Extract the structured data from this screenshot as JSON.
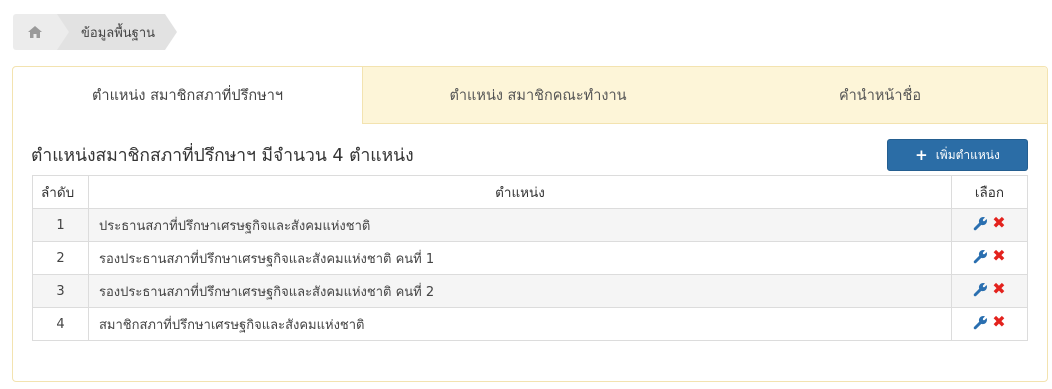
{
  "breadcrumb": {
    "home_icon": "home-icon",
    "current": "ข้อมูลพื้นฐาน"
  },
  "tabs": [
    {
      "label": "ตำแหน่ง สมาชิกสภาที่ปรึกษาฯ",
      "active": true
    },
    {
      "label": "ตำแหน่ง สมาชิกคณะทำงาน",
      "active": false
    },
    {
      "label": "คำนำหน้าชื่อ",
      "active": false
    }
  ],
  "section": {
    "heading": "ตำแหน่งสมาชิกสภาที่ปรึกษาฯ มีจำนวน 4 ตำแหน่ง",
    "add_button": "เพิ่มตำแหน่ง",
    "add_icon": "plus-icon"
  },
  "table": {
    "headers": {
      "no": "ลำดับ",
      "position": "ตำแหน่ง",
      "select": "เลือก"
    },
    "rows": [
      {
        "no": "1",
        "position": "ประธานสภาที่ปรึกษาเศรษฐกิจและสังคมแห่งชาติ"
      },
      {
        "no": "2",
        "position": "รองประธานสภาที่ปรึกษาเศรษฐกิจและสังคมแห่งชาติ คนที่ 1"
      },
      {
        "no": "3",
        "position": "รองประธานสภาที่ปรึกษาเศรษฐกิจและสังคมแห่งชาติ คนที่ 2"
      },
      {
        "no": "4",
        "position": "สมาชิกสภาที่ปรึกษาเศรษฐกิจและสังคมแห่งชาติ"
      }
    ],
    "edit_icon": "wrench-icon",
    "delete_icon": "delete-icon"
  },
  "colors": {
    "tab_bg": "#fdf5d8",
    "panel_border": "#f3e3b0",
    "button": "#2b6da6",
    "edit": "#2a6fb0",
    "delete": "#e3221d"
  }
}
